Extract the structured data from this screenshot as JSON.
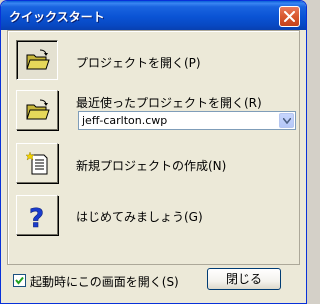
{
  "window": {
    "title": "クイックスタート"
  },
  "actions": [
    {
      "label": "プロジェクトを開く(P)",
      "icon": "open-folder-icon"
    },
    {
      "label": "最近使ったプロジェクトを開く(R)",
      "icon": "open-folder-icon"
    },
    {
      "label": "新規プロジェクトの作成(N)",
      "icon": "new-document-icon"
    },
    {
      "label": "はじめてみましょう(G)",
      "icon": "help-question-icon"
    }
  ],
  "recent_combo": {
    "selected": "jeff-carlton.cwp"
  },
  "footer": {
    "startup_checkbox_label": "起動時にこの画面を開く(S)",
    "startup_checkbox_checked": true,
    "close_label": "閉じる"
  },
  "colors": {
    "titlebar": "#0a53d4",
    "close_button": "#d9582f",
    "background": "#ece9d8",
    "help_icon": "#1a3ccc"
  }
}
